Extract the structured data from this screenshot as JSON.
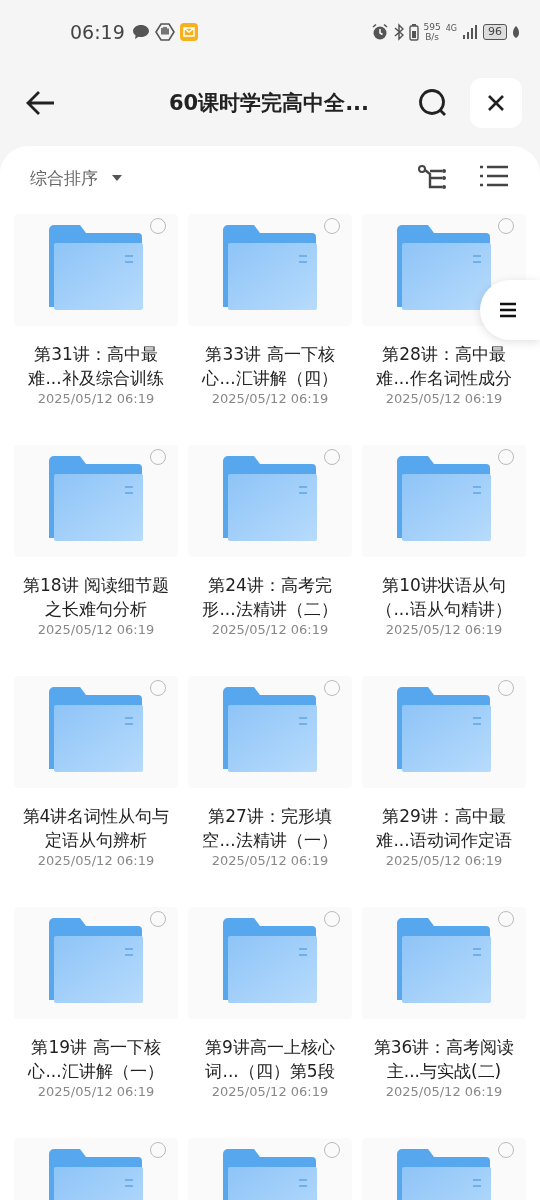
{
  "status_bar": {
    "time": "06:19",
    "net_speed_value": "595",
    "net_speed_unit": "B/s",
    "network": "4G",
    "battery": "96"
  },
  "header": {
    "title": "60课时学完高中全..."
  },
  "toolbar": {
    "sort_label": "综合排序"
  },
  "items": [
    {
      "title": "第31讲：高中最难...补及综合训练",
      "date": "2025/05/12 06:19",
      "selected": false
    },
    {
      "title": "第33讲 高一下核心...汇讲解（四）",
      "date": "2025/05/12 06:19",
      "selected": false
    },
    {
      "title": "第28讲：高中最难...作名词性成分",
      "date": "2025/05/12 06:19",
      "selected": false
    },
    {
      "title": "第18讲 阅读细节题之长难句分析",
      "date": "2025/05/12 06:19",
      "selected": false
    },
    {
      "title": "第24讲：高考完形...法精讲（二）",
      "date": "2025/05/12 06:19",
      "selected": false
    },
    {
      "title": "第10讲状语从句（...语从句精讲）",
      "date": "2025/05/12 06:19",
      "selected": false
    },
    {
      "title": "第4讲名词性从句与定语从句辨析",
      "date": "2025/05/12 06:19",
      "selected": false
    },
    {
      "title": "第27讲：完形填空...法精讲（一）",
      "date": "2025/05/12 06:19",
      "selected": false
    },
    {
      "title": "第29讲：高中最难...语动词作定语",
      "date": "2025/05/12 06:19",
      "selected": false
    },
    {
      "title": "第19讲 高一下核心...汇讲解（一）",
      "date": "2025/05/12 06:19",
      "selected": false
    },
    {
      "title": "第9讲高一上核心词...（四）第5段",
      "date": "2025/05/12 06:19",
      "selected": false
    },
    {
      "title": "第36讲：高考阅读主...与实战(二)",
      "date": "2025/05/12 06:19",
      "selected": false
    },
    {
      "selected": false
    },
    {
      "selected": false
    },
    {
      "selected": false
    }
  ]
}
